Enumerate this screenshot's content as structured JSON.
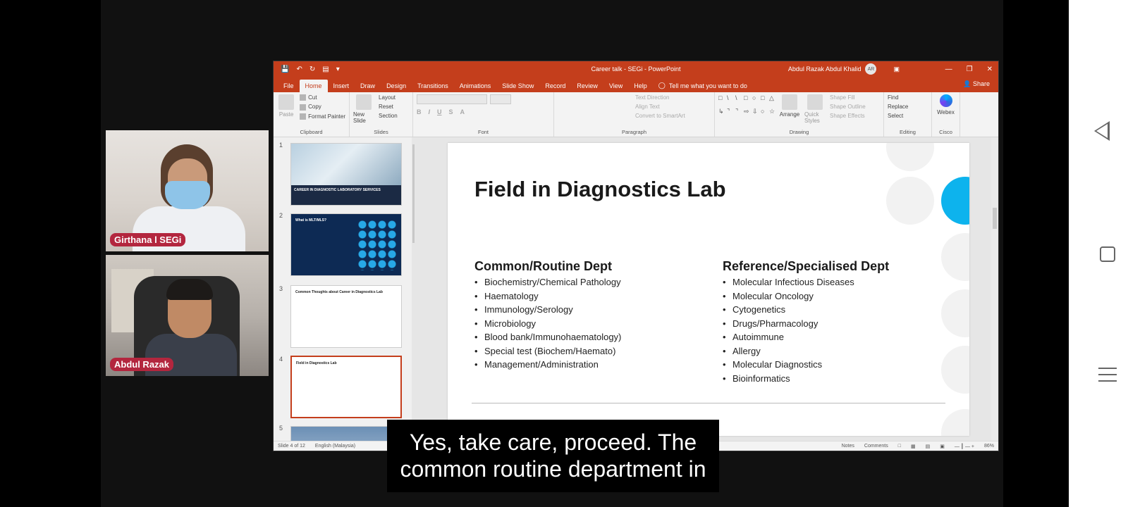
{
  "participants": [
    {
      "name": "Girthana l SEGi"
    },
    {
      "name": "Abdul Razak"
    }
  ],
  "ppt": {
    "title": "Career talk - SEGi - PowerPoint",
    "user": "Abdul Razak Abdul Khalid",
    "user_initials": "AR",
    "tabs": [
      "File",
      "Home",
      "Insert",
      "Draw",
      "Design",
      "Transitions",
      "Animations",
      "Slide Show",
      "Record",
      "Review",
      "View",
      "Help"
    ],
    "tell_me": "Tell me what you want to do",
    "share": "Share",
    "ribbon": {
      "clipboard": {
        "paste": "Paste",
        "cut": "Cut",
        "copy": "Copy",
        "format_painter": "Format Painter",
        "label": "Clipboard"
      },
      "slides": {
        "new_slide": "New Slide",
        "layout": "Layout",
        "reset": "Reset",
        "section": "Section",
        "label": "Slides"
      },
      "font": {
        "label": "Font"
      },
      "paragraph": {
        "text_direction": "Text Direction",
        "align_text": "Align Text",
        "convert_smartart": "Convert to SmartArt",
        "label": "Paragraph"
      },
      "drawing": {
        "arrange": "Arrange",
        "quick_styles": "Quick Styles",
        "shape_fill": "Shape Fill",
        "shape_outline": "Shape Outline",
        "shape_effects": "Shape Effects",
        "label": "Drawing"
      },
      "editing": {
        "find": "Find",
        "replace": "Replace",
        "select": "Select",
        "label": "Editing"
      },
      "cisco": {
        "webex": "Webex",
        "label": "Cisco"
      }
    },
    "thumbnails": [
      {
        "num": "1",
        "text": "CAREER IN DIAGNOSTIC LABORATORY SERVICES"
      },
      {
        "num": "2",
        "text": "What is MLT/MLS?"
      },
      {
        "num": "3",
        "text": "Common Thoughts about Career in Diagnostics Lab"
      },
      {
        "num": "4",
        "text": "Field in Diagnostics Lab"
      },
      {
        "num": "5",
        "text": ""
      }
    ],
    "slide": {
      "title": "Field in Diagnostics Lab",
      "left_heading": "Common/Routine Dept",
      "left_items": [
        "Biochemistry/Chemical Pathology",
        "Haematology",
        "Immunology/Serology",
        "Microbiology",
        "Blood bank/Immunohaematology)",
        "Special test (Biochem/Haemato)",
        "Management/Administration"
      ],
      "right_heading": "Reference/Specialised Dept",
      "right_items": [
        "Molecular Infectious Diseases",
        "Molecular Oncology",
        "Cytogenetics",
        "Drugs/Pharmacology",
        "Autoimmune",
        "Allergy",
        "Molecular Diagnostics",
        "Bioinformatics"
      ]
    },
    "status": {
      "slide_of": "Slide 4 of 12",
      "language": "English (Malaysia)",
      "notes": "Notes",
      "comments": "Comments",
      "zoom": "86%"
    }
  },
  "caption": {
    "line1": "Yes, take care, proceed. The",
    "line2": "common routine department in"
  }
}
